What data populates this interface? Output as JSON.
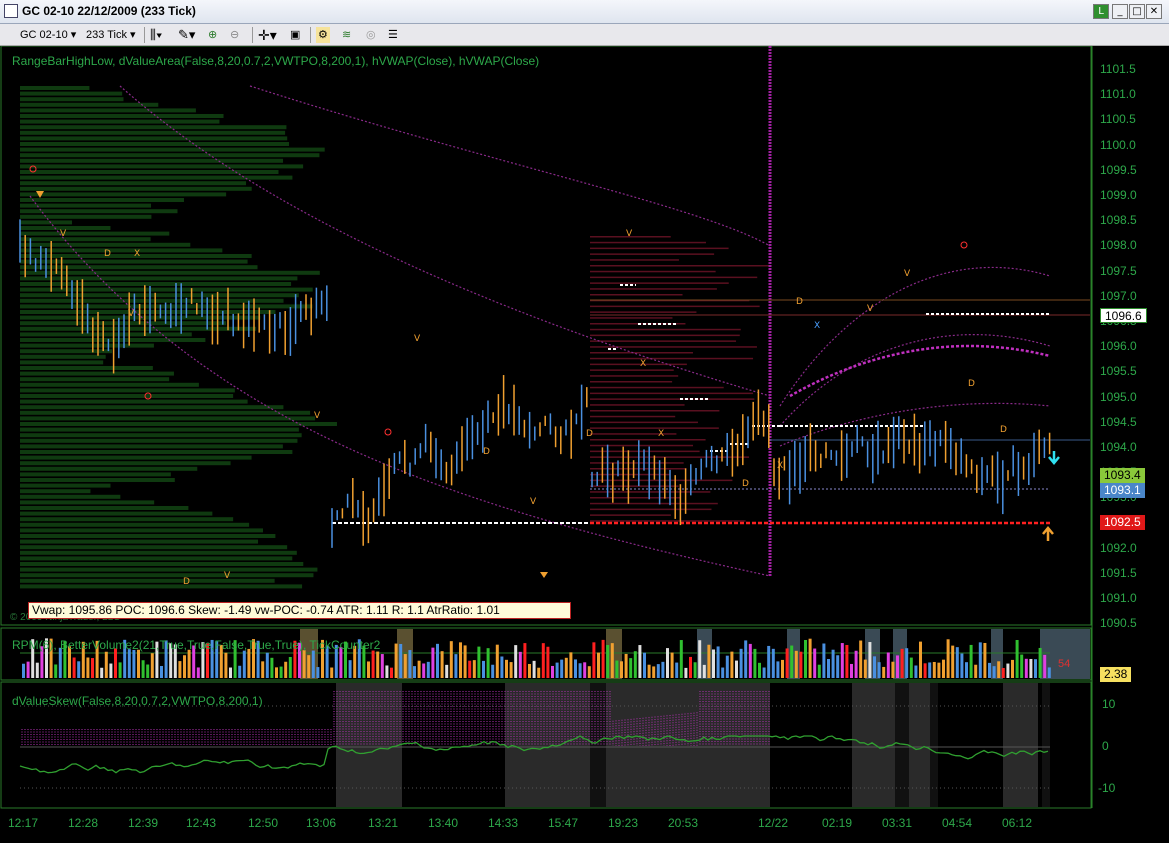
{
  "window": {
    "title": "GC 02-10  22/12/2009 (233 Tick)",
    "badge": "L",
    "min": "_",
    "max": "□",
    "close": "✕"
  },
  "toolbar": {
    "instrument": "GC 02-10",
    "interval": "233 Tick"
  },
  "price_panel": {
    "indicator_label": "RangeBarHighLow, dValueArea(False,8,20,0.7,2,VWTPO,8,200,1), hVWAP(Close), hVWAP(Close)",
    "copyright": "© 2009 NinjaTrader, LLC",
    "y_ticks": [
      "1101.5",
      "1101.0",
      "1100.5",
      "1100.0",
      "1099.5",
      "1099.0",
      "1098.5",
      "1098.0",
      "1097.5",
      "1097.0",
      "1096.5",
      "1096.0",
      "1095.5",
      "1095.0",
      "1094.5",
      "1094.0",
      "1093.5",
      "1093.0",
      "1092.5",
      "1092.0",
      "1091.5",
      "1091.0",
      "1090.5"
    ],
    "price_labels": {
      "p1": "1096.6",
      "p2": "1093.4",
      "p3": "1093.1",
      "p4": "1092.5"
    },
    "stats": "Vwap:  1095.86  POC:  1096.6  Skew:  -1.49  vw-POC:  -0.74  ATR:  1.11  R:  1.1  AtrRatio:  1.01"
  },
  "volume_panel": {
    "indicator_label": "RPM(6), BetterVolume2(21,True,True,False,True,True), TickCounter2",
    "counter": "54",
    "value_label": "2.38"
  },
  "skew_panel": {
    "indicator_label": "dValueSkew(False,8,20,0.7,2,VWTPO,8,200,1)",
    "y_ticks": [
      "10",
      "0",
      "-10"
    ]
  },
  "x_axis": [
    "12:17",
    "12:28",
    "12:39",
    "12:43",
    "12:50",
    "13:06",
    "13:21",
    "13:40",
    "14:33",
    "15:47",
    "19:23",
    "20:53",
    "12/22",
    "02:19",
    "03:31",
    "04:54",
    "06:12"
  ],
  "colors": {
    "axis_green": "#2da84a",
    "poc_red": "#ff2020",
    "vwap_purple": "#b22bb2",
    "bar_orange": "#f0a030",
    "bar_blue": "#4a90e0"
  }
}
